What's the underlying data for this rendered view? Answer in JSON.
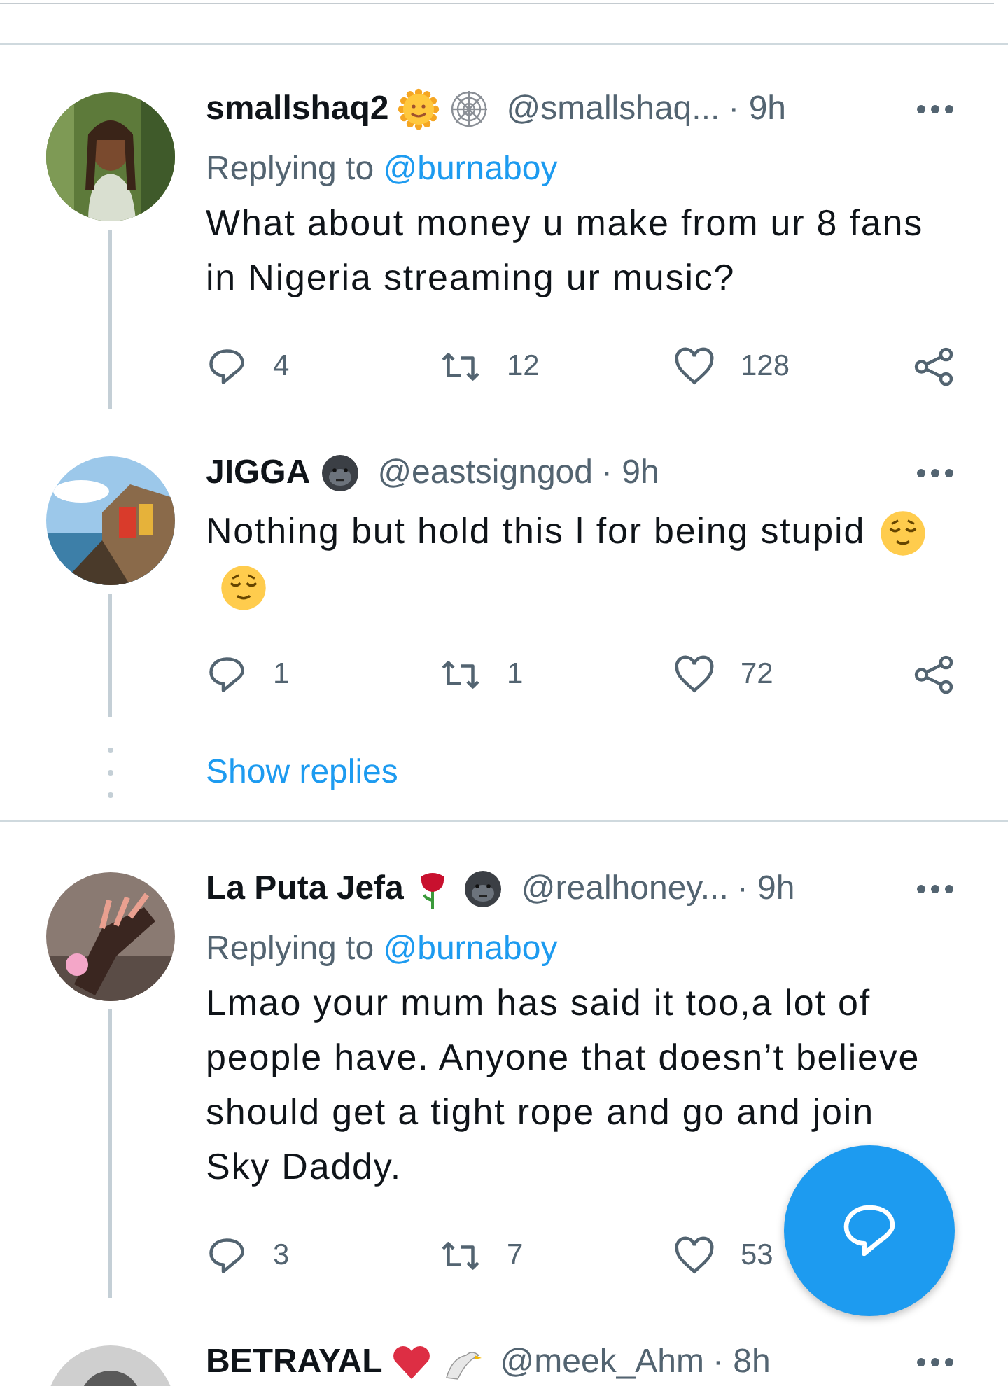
{
  "items": [
    {
      "kind": "tweet",
      "name": "smallshaq2",
      "badges": [
        {
          "kind": "sun"
        },
        {
          "kind": "web"
        }
      ],
      "handle": "@smallshaq...",
      "time": "· 9h",
      "replying_label": "Replying to",
      "replying_handle": "@burnaboy",
      "text": "What about money u make from ur 8 fans in Nigeria streaming ur music?",
      "reply_count": "4",
      "retweet_count": "12",
      "like_count": "128",
      "share": true,
      "thread_line": true
    },
    {
      "kind": "tweet",
      "name": "JIGGA",
      "badges": [
        {
          "kind": "gorilla"
        }
      ],
      "handle": "@eastsigngod",
      "time": "· 9h",
      "text": "Nothing but hold this l for being stupid",
      "text_icons": [
        {
          "kind": "relieved"
        },
        {
          "kind": "relieved"
        }
      ],
      "reply_count": "1",
      "retweet_count": "1",
      "like_count": "72",
      "share": true,
      "thread_line": true
    },
    {
      "kind": "show_replies",
      "label": "Show replies"
    },
    {
      "kind": "tweet",
      "name": "La Puta Jefa",
      "badges": [
        {
          "kind": "rose"
        },
        {
          "kind": "gorilla"
        }
      ],
      "handle": "@realhoney...",
      "time": "· 9h",
      "replying_label": "Replying to",
      "replying_handle": "@burnaboy",
      "text": "Lmao your mum has said it too,a lot of people have. Anyone that doesn’t believe should get a tight rope and go and join Sky Daddy.",
      "reply_count": "3",
      "retweet_count": "7",
      "like_count": "53",
      "share": false,
      "thread_line": true
    },
    {
      "kind": "tweet",
      "name": "BETRAYAL",
      "badges": [
        {
          "kind": "heart"
        },
        {
          "kind": "eagle"
        }
      ],
      "handle": "@meek_Ahm",
      "time": "· 8h"
    }
  ]
}
